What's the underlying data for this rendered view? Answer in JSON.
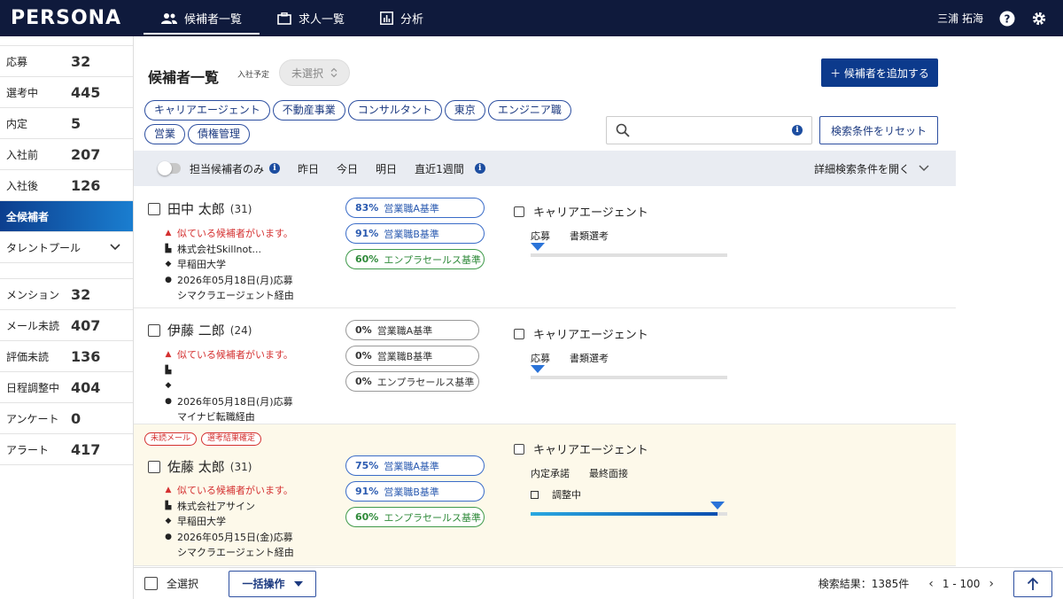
{
  "app": {
    "logo": "PERSONA"
  },
  "nav": [
    {
      "label": "候補者一覧"
    },
    {
      "label": "求人一覧"
    },
    {
      "label": "分析"
    }
  ],
  "user": {
    "name": "三浦 拓海"
  },
  "sidebar": {
    "stats1": [
      {
        "label": "応募",
        "count": "32"
      },
      {
        "label": "選考中",
        "count": "445"
      },
      {
        "label": "内定",
        "count": "5"
      },
      {
        "label": "入社前",
        "count": "207"
      },
      {
        "label": "入社後",
        "count": "126"
      }
    ],
    "all_candidates": "全候補者",
    "talent_pool": "タレントプール",
    "stats2": [
      {
        "label": "メンション",
        "count": "32"
      },
      {
        "label": "メール未読",
        "count": "407"
      },
      {
        "label": "評価未読",
        "count": "136"
      },
      {
        "label": "日程調整中",
        "count": "404"
      },
      {
        "label": "アンケート",
        "count": "0"
      },
      {
        "label": "アラート",
        "count": "417"
      }
    ]
  },
  "main": {
    "title": "候補者一覧",
    "join_label": "入社予定",
    "join_value": "未選択",
    "add_button": "＋ 候補者を追加する",
    "tags": [
      "キャリアエージェント",
      "不動産事業",
      "コンサルタント",
      "東京",
      "エンジニア職",
      "営業",
      "債権管理"
    ],
    "reset_button": "検索条件をリセット",
    "filter": {
      "mine_only": "担当候補者のみ",
      "dates": [
        "昨日",
        "今日",
        "明日",
        "直近1週間"
      ],
      "detail": "詳細検索条件を開く"
    }
  },
  "candidates": [
    {
      "name": "田中 太郎",
      "age": "(31)",
      "warning": "似ている候補者がいます。",
      "company": "株式会社Skillnot...",
      "school": "早稲田大学",
      "applied": "2026年05月18日(月)応募",
      "via": "シマクラエージェント経由",
      "scores": [
        {
          "pct": "83%",
          "label": "営業職A基準"
        },
        {
          "pct": "91%",
          "label": "営業職B基準"
        },
        {
          "pct": "60%",
          "label": "エンプラセールス基準"
        }
      ],
      "agent": "キャリアエージェント",
      "stages": [
        "応募",
        "書類選考"
      ],
      "progress": 0
    },
    {
      "name": "伊藤 二郎",
      "age": "(24)",
      "warning": "似ている候補者がいます。",
      "company": "",
      "school": "",
      "applied": "2026年05月18日(月)応募",
      "via": "マイナビ転職経由",
      "scores": [
        {
          "pct": "0%",
          "label": "営業職A基準"
        },
        {
          "pct": "0%",
          "label": "営業職B基準"
        },
        {
          "pct": "0%",
          "label": "エンプラセールス基準"
        }
      ],
      "agent": "キャリアエージェント",
      "stages": [
        "応募",
        "書類選考"
      ],
      "progress": 0
    },
    {
      "badges": [
        "未読メール",
        "選考結果確定"
      ],
      "name": "佐藤 太郎",
      "age": "(31)",
      "warning": "似ている候補者がいます。",
      "company": "株式会社アサイン",
      "school": "早稲田大学",
      "applied": "2026年05月15日(金)応募",
      "via": "シマクラエージェント経由",
      "scores": [
        {
          "pct": "75%",
          "label": "営業職A基準"
        },
        {
          "pct": "91%",
          "label": "営業職B基準"
        },
        {
          "pct": "60%",
          "label": "エンプラセールス基準"
        }
      ],
      "agent": "キャリアエージェント",
      "stages": [
        "内定承諾",
        "最終面接"
      ],
      "status": "調整中",
      "progress": 0.95
    }
  ],
  "bottom": {
    "select_all": "全選択",
    "bulk": "一括操作",
    "result": "検索結果：1385件",
    "range": "1 - 100"
  }
}
